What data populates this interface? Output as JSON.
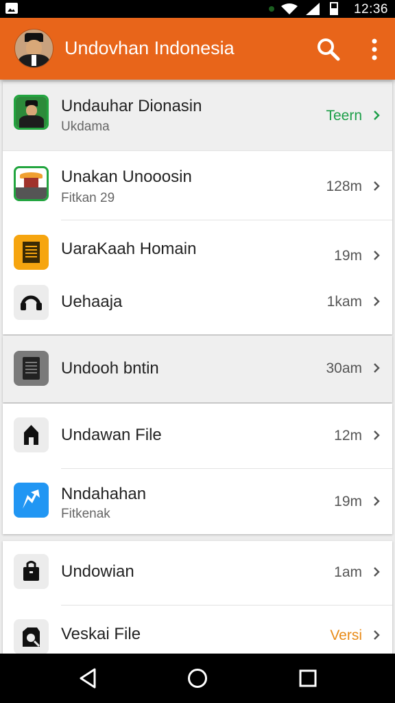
{
  "status_bar": {
    "time": "12:36"
  },
  "app_bar": {
    "title": "Undovhan Indonesia"
  },
  "colors": {
    "accent": "#e8651a",
    "green": "#1c9e48",
    "orange_text": "#e88a16",
    "nav_bg": "#000000"
  },
  "groups": [
    {
      "items": [
        {
          "title": "Undauhar Dionasin",
          "subtitle": "Ukdama",
          "meta": "Teern",
          "icon": "portrait-photo-icon"
        },
        {
          "title": "Unakan Unooosin",
          "subtitle": "Fitkan 29",
          "meta": "128m",
          "icon": "hut-photo-icon"
        },
        {
          "title": "UaraKaah Homain",
          "subtitle": "",
          "meta": "19m",
          "icon": "document-icon"
        },
        {
          "title": "Uehaaja",
          "subtitle": "",
          "meta": "1kam",
          "icon": "headset-icon"
        }
      ]
    },
    {
      "items": [
        {
          "title": "Undooh bntin",
          "subtitle": "",
          "meta": "30am",
          "icon": "file-icon"
        }
      ]
    },
    {
      "items": [
        {
          "title": "Undawan File",
          "subtitle": "",
          "meta": "12m",
          "icon": "home-icon"
        },
        {
          "title": "Nndahahan",
          "subtitle": "Fitkenak",
          "meta": "19m",
          "icon": "share-icon"
        }
      ]
    },
    {
      "items": [
        {
          "title": "Undowian",
          "subtitle": "",
          "meta": "1am",
          "icon": "bag-icon"
        },
        {
          "title": "Veskai File",
          "subtitle": "",
          "meta": "Versi",
          "icon": "camera-icon"
        }
      ]
    }
  ]
}
